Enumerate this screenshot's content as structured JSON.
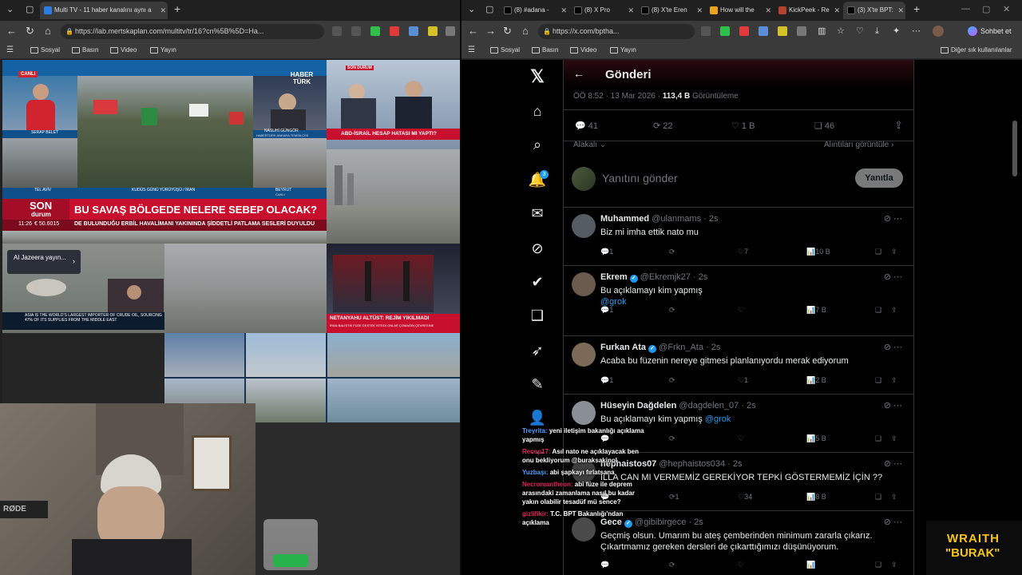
{
  "left_window": {
    "tab_title": "Multi TV - 11 haber kanalını aynı a",
    "url": "https://lab.mertskaplan.com/multitv/tr/16?cn%5B%5D=Ha...",
    "bookmarks": [
      "Sosyal",
      "Basın",
      "Video",
      "Yayın"
    ]
  },
  "right_window": {
    "tabs": [
      {
        "title": "(8) #adana -",
        "icon": "x-icon"
      },
      {
        "title": "(8) X Pro",
        "icon": "x-icon"
      },
      {
        "title": "(8) X'te Eren",
        "icon": "x-icon"
      },
      {
        "title": "How will the",
        "icon": "article-icon"
      },
      {
        "title": "KickPeek - Re",
        "icon": "kick-icon"
      },
      {
        "title": "(3) X'te BPT:",
        "icon": "x-icon"
      }
    ],
    "url": "https://x.com/bptha...",
    "chat_button": "Sohbet et",
    "bookmarks": [
      "Sosyal",
      "Basın",
      "Video",
      "Yayın"
    ],
    "other_bookmarks": "Diğer sık kullanılanlar"
  },
  "tv": {
    "live_badge": "CANLI",
    "anchor_name": "SERAP BELET",
    "channel_logo": "HABER TÜRK",
    "reporter_name": "NASUHİ GÜNGÖR",
    "reporter_role": "HABERTÜRK ANKARA TEMSİLCİSİ",
    "loc_tel_aviv": "TEL AVİV",
    "loc_kudus": "KUDÜS GÜNÜ YÜRÜYÜŞÜ / İRAN",
    "loc_beyrut": "BEYRUT",
    "loc_canli": "CANLI",
    "son_durum_1": "SON",
    "son_durum_2": "durum",
    "headline": "BU SAVAŞ BÖLGEDE NELERE SEBEP OLACAK?",
    "time": "11:26",
    "euro": "€ 50.6015",
    "ticker": "DE BULUNDUĞU ERBİL HAVALİMANI YAKININDA ŞİDDETLİ PATLAMA SESLERİ DUYULDU",
    "abd_headline": "ABD-İSRAİL HESAP HATASI MI YAPTI?",
    "son_dakika": "SON DURUM",
    "aljazeera_label": "Al Jazeera yayın...",
    "aljazeera_ticker": "ASIA IS THE WORLD'S LARGEST IMPORTER OF CRUDE OIL, SOURCING 47% OF ITS SUPPLIES FROM THE MIDDLE EAST",
    "netanyahu_head": "NETANYAHU ALTÜST: REJİM YIKILMADI",
    "netanyahu_sub": "İRAN BALİSTİK FÜZE DESTEK İSTEDİ ONLAR ÇOMAĞIN ÇEVRESİNE"
  },
  "x": {
    "header_title": "Gönderi",
    "meta_time": "ÖÖ 8:52 · 13 Mar 2026 · ",
    "meta_views_count": "113,4 B",
    "meta_views_label": " Görüntüleme",
    "stats": {
      "replies": "41",
      "reposts": "22",
      "likes": "1 B",
      "bookmarks": "46"
    },
    "sort_label": "Alakalı",
    "quotes_link": "Alıntıları görüntüle",
    "reply_placeholder": "Yanıtını gönder",
    "reply_button": "Yanıtla",
    "notif_count": "3",
    "posts": [
      {
        "name": "Muhammed",
        "handle": "@ulanmams · 2s",
        "text": "Biz mi imha ettik nato mu",
        "link": "",
        "replies": "1",
        "reposts": "",
        "likes": "7",
        "views": "10 B",
        "avatar": "#555b63",
        "verified": false
      },
      {
        "name": "Ekrem",
        "handle": "@Ekremjk27 · 2s",
        "text": "Bu açıklamayı kim yapmış",
        "link": "@grok",
        "replies": "1",
        "reposts": "",
        "likes": "",
        "views": "7 B",
        "avatar": "#6b5a4e",
        "verified": true
      },
      {
        "name": "Furkan Ata",
        "handle": "@Frkn_Ata · 2s",
        "text": "Acaba bu füzenin nereye gitmesi planlanıyordu merak ediyorum",
        "link": "",
        "replies": "1",
        "reposts": "",
        "likes": "1",
        "views": "2 B",
        "avatar": "#7b6a58",
        "verified": true
      },
      {
        "name": "Hüseyin Dağdelen",
        "handle": "@dagdelen_07 · 2s",
        "text": "Bu açıklamayı kim yapmış ",
        "link": "@grok",
        "replies": "",
        "reposts": "",
        "likes": "",
        "views": "5 B",
        "avatar": "#8a8f96",
        "verified": false
      },
      {
        "name": "hephaistos07",
        "handle": "@hephaistos034 · 2s",
        "text": "İLLA CAN MI VERMEMİZ GEREKİYOR TEPKİ GÖSTERMEMİZ İÇİN ??",
        "link": "",
        "replies": "",
        "reposts": "1",
        "likes": "34",
        "views": "8 B",
        "avatar": "#3e3e3e",
        "verified": false
      },
      {
        "name": "Gece",
        "handle": "@gibibirgece · 2s",
        "text": "Geçmiş olsun. Umarım bu ateş çemberinden minimum zararla çıkarız. Çıkartmamız gereken dersleri de çıkarttığımızı düşünüyorum.",
        "link": "",
        "replies": "",
        "reposts": "",
        "likes": "",
        "views": "",
        "avatar": "#4a4a4a",
        "verified": true
      }
    ]
  },
  "chat": [
    {
      "user": "Treyrita:",
      "text": "yeni iletişim bakanlığı açıklama yapmış"
    },
    {
      "user": "Recep17:",
      "text": "Asıl nato ne açıklayacak ben onu bekliyorum @buraksakinol"
    },
    {
      "user": "Yuzbaşı:",
      "text": "abi şapkayı fırlatsana"
    },
    {
      "user": "Necromantheon:",
      "text": "abi füze ile deprem arasındaki zamanlama nasıl bu kadar yakın olabilir tesadüf mü sence?"
    },
    {
      "user": "gizlifikir:",
      "text": "T.C. BPT Bakanlığı'ndan açıklama"
    }
  ],
  "brand": {
    "line1": "WRAITH",
    "line2": "\"BURAK\""
  },
  "colors": {
    "x_blue": "#1d9bf0",
    "brand_yellow": "#f5c518",
    "son_durum_red": "#c8102e"
  }
}
